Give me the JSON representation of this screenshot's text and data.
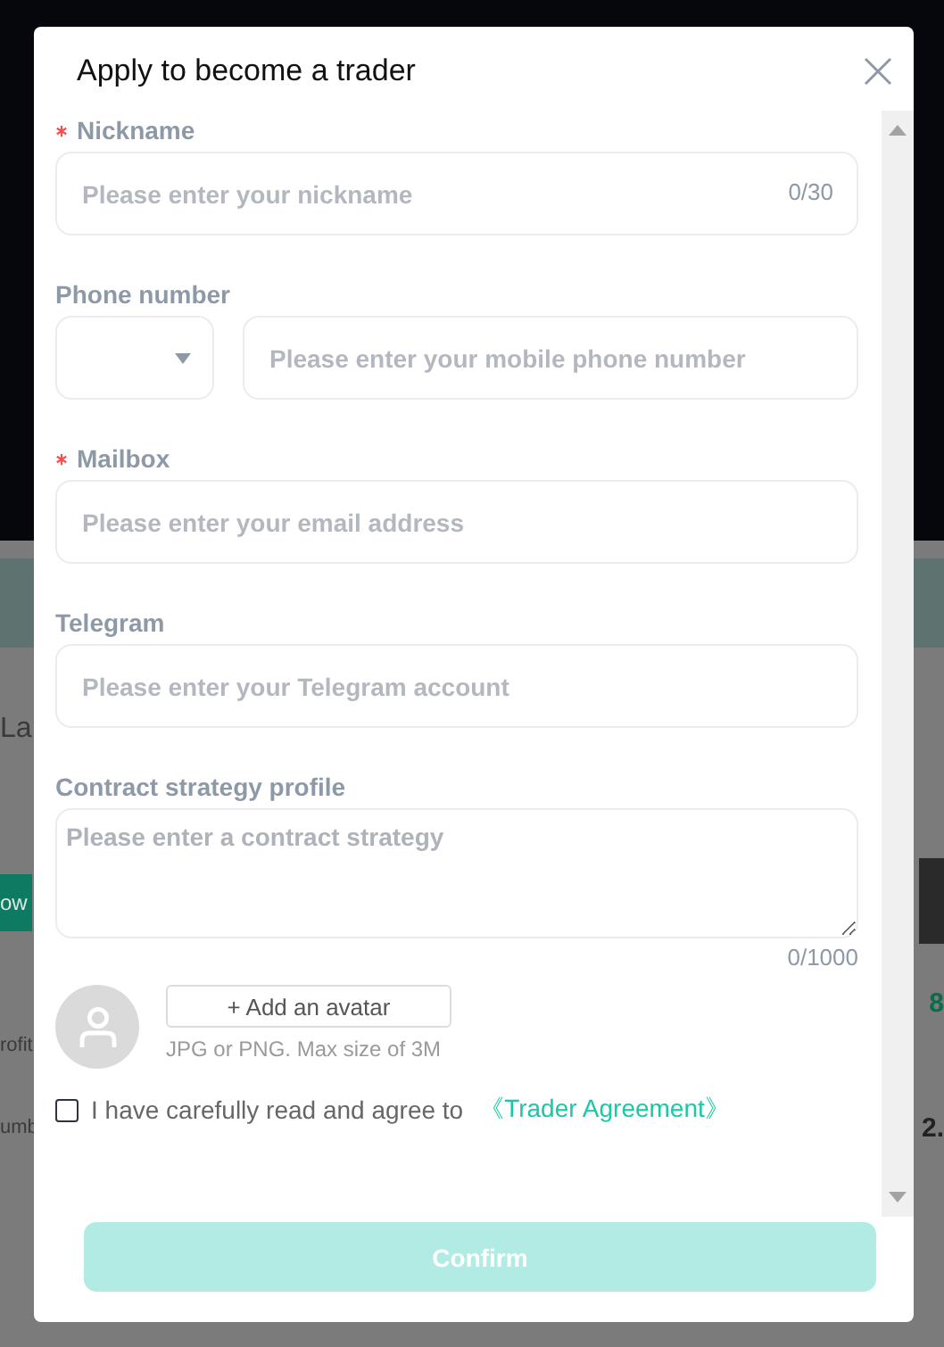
{
  "dialog": {
    "title": "Apply to become a trader"
  },
  "fields": [
    {
      "kind": "text",
      "label": "Nickname",
      "required": true,
      "placeholder": "Please enter your nickname",
      "counter": "0/30"
    },
    {
      "kind": "phone",
      "label": "Phone number",
      "required": false,
      "placeholder": "Please enter your mobile phone number"
    },
    {
      "kind": "text",
      "label": "Mailbox",
      "required": true,
      "placeholder": "Please enter your email address"
    },
    {
      "kind": "text",
      "label": "Telegram",
      "required": false,
      "placeholder": "Please enter your Telegram account"
    },
    {
      "kind": "textarea",
      "label": "Contract strategy profile",
      "required": false,
      "placeholder": "Please enter a contract strategy",
      "counter": "0/1000"
    }
  ],
  "avatar": {
    "button": "+ Add an avatar",
    "hint": "JPG or PNG. Max size of 3M"
  },
  "agreement": {
    "checked": false,
    "text": "I have carefully read and agree to",
    "link": "《Trader Agreement》"
  },
  "confirm": {
    "label": "Confirm",
    "disabled": true
  },
  "background": {
    "left_texts": [
      "La",
      "rofit",
      "umb"
    ],
    "follow_button": "ow",
    "right_texts": [
      "8",
      "2."
    ]
  }
}
